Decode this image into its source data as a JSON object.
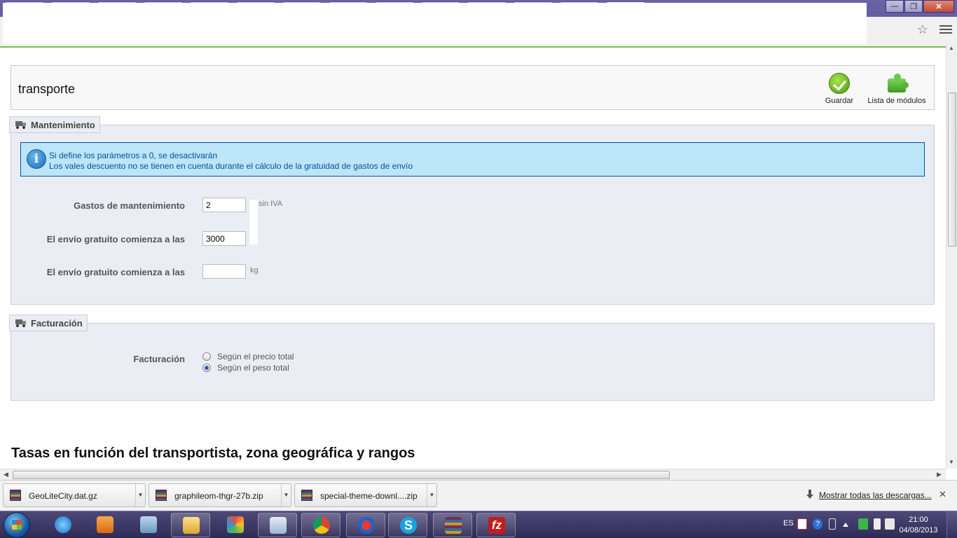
{
  "module": {
    "title": "transporte",
    "save_label": "Guardar",
    "modules_label": "Lista de módulos"
  },
  "maintenance": {
    "legend": "Mantenimiento",
    "info_line1": "Si define los parámetros a 0, se desactivarán",
    "info_line2": "Los vales descuento no se tienen en cuenta durante el cálculo de la gratuidad de gastos de envío",
    "fields": [
      {
        "label": "Gastos de mantenimiento",
        "value": "2",
        "unit": "sin IVA"
      },
      {
        "label": "El envío gratuito comienza a las",
        "value": "3000",
        "unit": ""
      },
      {
        "label": "El envío gratuito comienza a las",
        "value": "",
        "unit": "kg"
      }
    ]
  },
  "billing": {
    "legend": "Facturación",
    "label": "Facturación",
    "options": [
      {
        "label": "Según el precio total",
        "checked": false
      },
      {
        "label": "Según el peso total",
        "checked": true
      }
    ]
  },
  "rates_heading": "Tasas en función del transportista, zona geográfica y rangos",
  "downloads": {
    "items": [
      "GeoLiteCity.dat.gz",
      "graphileom-thgr-27b.zip",
      "special-theme-downl....zip"
    ],
    "show_all": "Mostrar todas las descargas..."
  },
  "taskbar": {
    "language": "ES",
    "time": "21:00",
    "date": "04/08/2013"
  }
}
